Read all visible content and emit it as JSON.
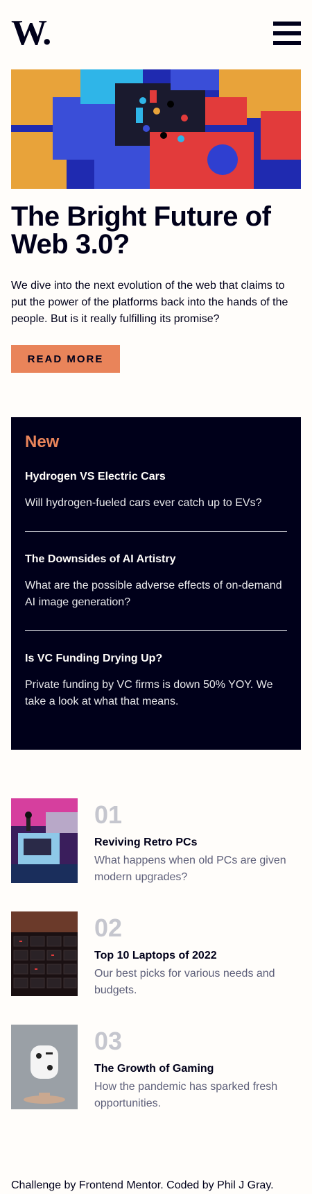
{
  "header": {
    "logo": "W.",
    "menu_icon": "hamburger-menu-icon"
  },
  "hero": {
    "title": "The Bright Future of Web 3.0?",
    "text": "We dive into the next evolution of the web that claims to put the power of the platforms back into the hands of the people. But is it really fulfilling its promise?",
    "button_label": "READ MORE"
  },
  "new_panel": {
    "heading": "New",
    "items": [
      {
        "title": "Hydrogen VS Electric Cars",
        "text": "Will hydrogen-fueled cars ever catch up to EVs?"
      },
      {
        "title": "The Downsides of AI Artistry",
        "text": "What are the possible adverse effects of on-demand AI image generation?"
      },
      {
        "title": "Is VC Funding Drying Up?",
        "text": "Private funding by VC firms is down 50% YOY. We take a look at what that means."
      }
    ]
  },
  "list": [
    {
      "number": "01",
      "title": "Reviving Retro PCs",
      "text": "What happens when old PCs are given modern upgrades?"
    },
    {
      "number": "02",
      "title": "Top 10 Laptops of 2022",
      "text": "Our best picks for various needs and budgets."
    },
    {
      "number": "03",
      "title": "The Growth of Gaming",
      "text": "How the pandemic has sparked fresh opportunities."
    }
  ],
  "footer": {
    "text": "Challenge by Frontend Mentor. Coded by Phil J Gray."
  },
  "colors": {
    "dark": "#00001a",
    "accent": "#e9845a",
    "muted": "#5d5f79",
    "light_gray": "#c5c6ce",
    "background": "#fffdfa"
  }
}
